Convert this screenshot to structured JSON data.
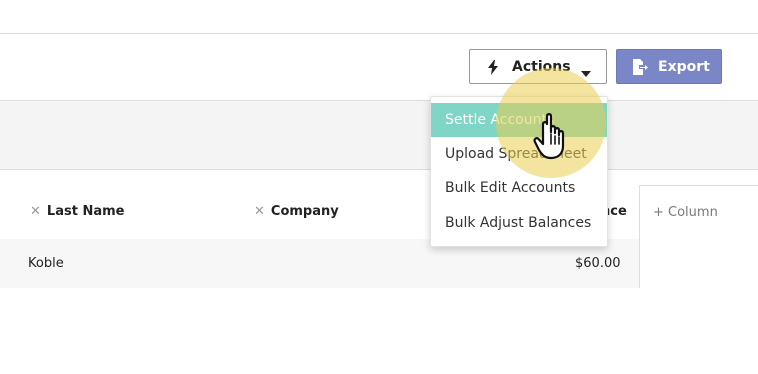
{
  "toolbar": {
    "actions_label": "Actions",
    "export_label": "Export",
    "export_color": "#7b86c7"
  },
  "table": {
    "columns": [
      {
        "label": "Last Name"
      },
      {
        "label": "Company"
      },
      {
        "label": "nce"
      }
    ],
    "add_column_label": "+ Column",
    "rows": [
      {
        "last_name": "Koble",
        "company": "",
        "balance": "$60.00"
      }
    ]
  },
  "menu": {
    "items": [
      {
        "label": "Settle Accounts"
      },
      {
        "label": "Upload Spreadsheet"
      },
      {
        "label": "Bulk Edit Accounts"
      },
      {
        "label": "Bulk Adjust Balances"
      }
    ],
    "active_index": 0,
    "active_color": "#7fd6c6"
  },
  "icons": {
    "actions": "lightning-bolt-icon",
    "actions_caret": "caret-down-icon",
    "export": "file-export-icon",
    "remove_column": "close-icon",
    "cursor": "hand-pointer-cursor"
  }
}
